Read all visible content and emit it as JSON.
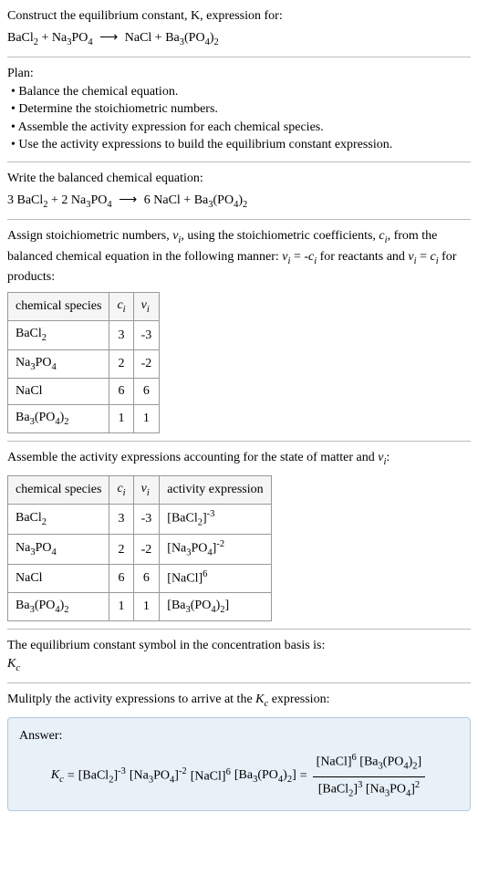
{
  "header": {
    "prompt": "Construct the equilibrium constant, K, expression for:",
    "unbalanced_lhs1": "BaCl",
    "unbalanced_lhs1_sub": "2",
    "plus1": " + Na",
    "unbalanced_lhs2_sub": "3",
    "unbalanced_lhs2b": "PO",
    "unbalanced_lhs2b_sub": "4",
    "arrow": " ⟶ ",
    "unbalanced_rhs1": "NaCl + Ba",
    "unbalanced_rhs2_sub": "3",
    "unbalanced_rhs2b": "(PO",
    "unbalanced_rhs2b_sub": "4",
    "unbalanced_rhs2c": ")",
    "unbalanced_rhs2c_sub": "2"
  },
  "plan": {
    "title": "Plan:",
    "b1": "• Balance the chemical equation.",
    "b2": "• Determine the stoichiometric numbers.",
    "b3": "• Assemble the activity expression for each chemical species.",
    "b4": "• Use the activity expressions to build the equilibrium constant expression."
  },
  "balanced": {
    "title": "Write the balanced chemical equation:",
    "c1": "3 BaCl",
    "c1sub": "2",
    "plus1": " + 2 Na",
    "c2sub": "3",
    "c2b": "PO",
    "c2bsub": "4",
    "arrow": " ⟶ ",
    "c3": "6 NaCl + Ba",
    "c4sub": "3",
    "c4b": "(PO",
    "c4bsub": "4",
    "c4c": ")",
    "c4csub": "2"
  },
  "stoich": {
    "intro1": "Assign stoichiometric numbers, ",
    "nu": "ν",
    "sub_i": "i",
    "intro2": ", using the stoichiometric coefficients, ",
    "c": "c",
    "intro3": ", from the balanced chemical equation in the following manner: ",
    "rel_reactants": " = -",
    "intro4": " for reactants and ",
    "rel_products": " = ",
    "intro5": " for products:",
    "headers": {
      "species": "chemical species",
      "ci": "c",
      "nui": "ν"
    },
    "rows": [
      {
        "species_a": "BaCl",
        "species_sub": "2",
        "ci": "3",
        "nui": "-3"
      },
      {
        "species_a": "Na",
        "species_sub1": "3",
        "species_b": "PO",
        "species_sub2": "4",
        "ci": "2",
        "nui": "-2"
      },
      {
        "species_a": "NaCl",
        "ci": "6",
        "nui": "6"
      },
      {
        "species_a": "Ba",
        "species_sub1": "3",
        "species_b": "(PO",
        "species_sub2": "4",
        "species_c": ")",
        "species_sub3": "2",
        "ci": "1",
        "nui": "1"
      }
    ]
  },
  "activity": {
    "intro1": "Assemble the activity expressions accounting for the state of matter and ",
    "intro2": ":",
    "headers": {
      "species": "chemical species",
      "ci": "c",
      "nui": "ν",
      "act": "activity expression"
    },
    "rows": [
      {
        "ci": "3",
        "nui": "-3",
        "exp": "-3"
      },
      {
        "ci": "2",
        "nui": "-2",
        "exp": "-2"
      },
      {
        "ci": "6",
        "nui": "6",
        "exp": "6"
      },
      {
        "ci": "1",
        "nui": "1",
        "exp": ""
      }
    ]
  },
  "symbol": {
    "line1": "The equilibrium constant symbol in the concentration basis is:",
    "K": "K",
    "sub_c": "c"
  },
  "multiply": {
    "line": "Mulitply the activity expressions to arrive at the ",
    "K": "K",
    "sub_c": "c",
    "line2": " expression:"
  },
  "answer": {
    "label": "Answer:",
    "K": "K",
    "sub_c": "c",
    "eq": " = ",
    "exp_bacl2": "-3",
    "exp_na3po4": "-2",
    "exp_nacl": "6",
    "eq2": " = ",
    "num_exp_nacl": "6",
    "den_exp_bacl2": "3",
    "den_exp_na3po4": "2"
  }
}
